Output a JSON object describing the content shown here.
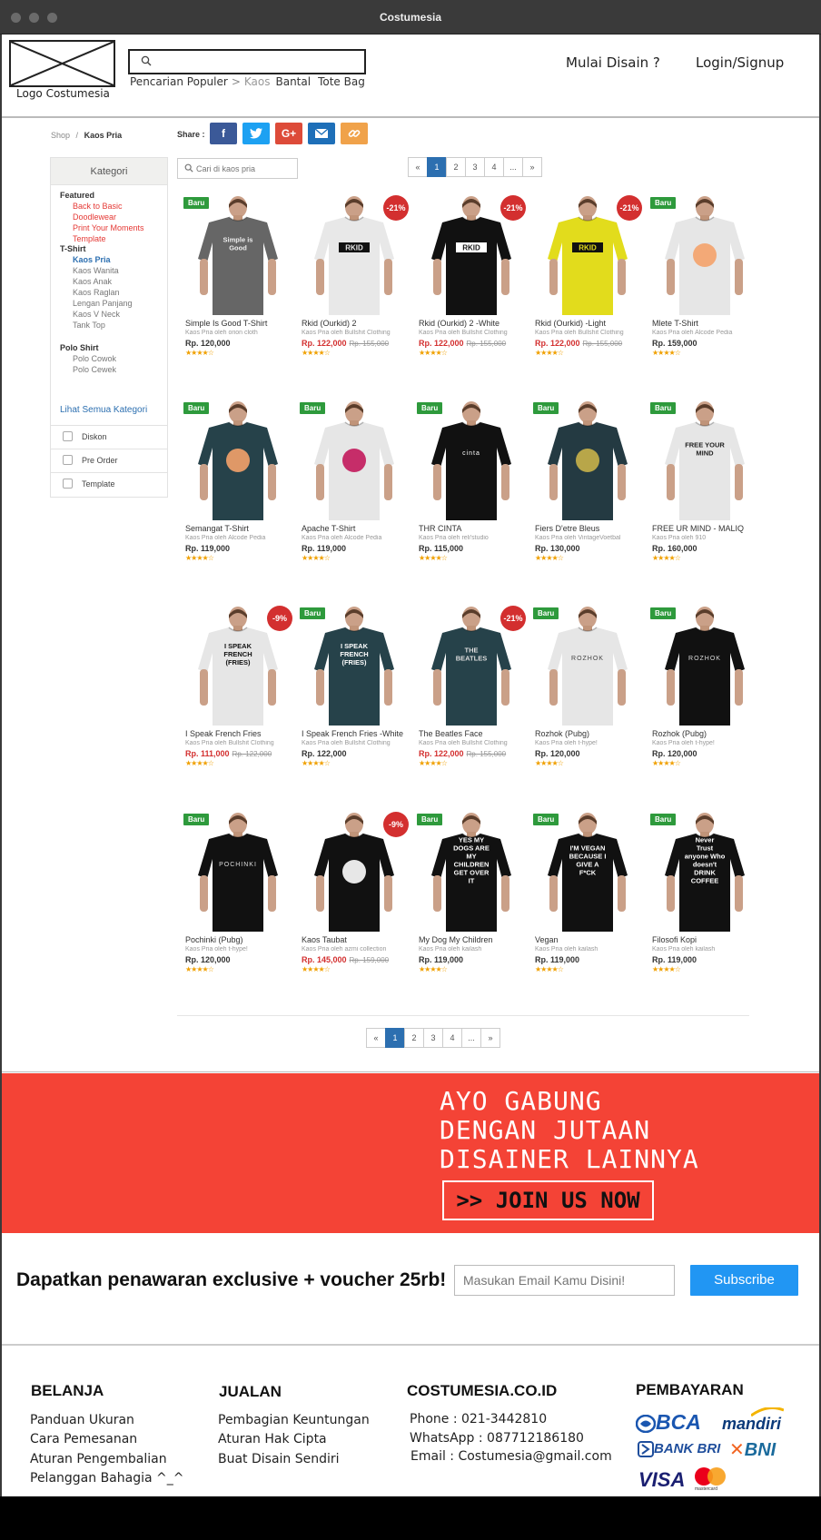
{
  "window": {
    "title": "Costumesia"
  },
  "header": {
    "logo_caption": "Logo Costumesia",
    "search_placeholder": "",
    "popular_label": "Pencarian Populer",
    "popular_sep": ">",
    "popular_tags": [
      "Kaos",
      "Bantal",
      "Tote Bag"
    ],
    "nav": {
      "design": "Mulai Disain ?",
      "login": "Login/Signup"
    }
  },
  "breadcrumb": {
    "root": "Shop",
    "sep": "/",
    "current": "Kaos Pria"
  },
  "share": {
    "label": "Share :",
    "buttons": [
      "f",
      "t",
      "G+",
      "✉",
      "🔗"
    ]
  },
  "sidebar": {
    "title": "Kategori",
    "groups": [
      {
        "label": "Featured",
        "items": [
          "Back to Basic",
          "Doodlewear",
          "Print Your Moments",
          "Template"
        ]
      },
      {
        "label": "T-Shirt",
        "items": [
          "Kaos Pria",
          "Kaos Wanita",
          "Kaos Anak",
          "Kaos Raglan",
          "Lengan Panjang",
          "Kaos V Neck",
          "Tank Top"
        ]
      },
      {
        "label": "Polo Shirt",
        "items": [
          "Polo Cowok",
          "Polo Cewek"
        ]
      }
    ],
    "see_all": "Lihat Semua Kategori",
    "filters": [
      "Diskon",
      "Pre Order",
      "Template"
    ]
  },
  "product_search": {
    "placeholder": "Cari di kaos pria"
  },
  "pagination": [
    "«",
    "1",
    "2",
    "3",
    "4",
    "...",
    "»"
  ],
  "pagination_active": "1",
  "products": [
    {
      "name": "Simple Is Good T-Shirt",
      "seller": "Kaos Pria oleh orion cloth",
      "price": "Rp. 120,000",
      "old": "",
      "badge": "Baru",
      "disc": "",
      "shirt": "#666666",
      "art": "Simple is Good",
      "art_color": "#eeeeee"
    },
    {
      "name": "Rkid (Ourkid) 2",
      "seller": "Kaos Pria oleh Bullshit Clothing",
      "price": "Rp. 122,000",
      "old": "Rp. 155,000",
      "badge": "",
      "disc": "-21%",
      "shirt": "#e8e8e8",
      "art": "RKID",
      "art_color": "#111111"
    },
    {
      "name": "Rkid (Ourkid) 2 -White",
      "seller": "Kaos Pria oleh Bullshit Clothing",
      "price": "Rp. 122,000",
      "old": "Rp. 155,000",
      "badge": "",
      "disc": "-21%",
      "shirt": "#111111",
      "art": "RKID",
      "art_color": "#ffffff"
    },
    {
      "name": "Rkid (Ourkid) -Light",
      "seller": "Kaos Pria oleh Bullshit Clothing",
      "price": "Rp. 122,000",
      "old": "Rp. 155,000",
      "badge": "",
      "disc": "-21%",
      "shirt": "#e2dc1c",
      "art": "RKID",
      "art_color": "#111111"
    },
    {
      "name": "Mlete T-Shirt",
      "seller": "Kaos Pria oleh Alcode Pedia",
      "price": "Rp. 159,000",
      "old": "",
      "badge": "Baru",
      "disc": "",
      "shirt": "#e6e6e6",
      "art": "",
      "art_color": "#f4a26a"
    },
    {
      "name": "Semangat T-Shirt",
      "seller": "Kaos Pria oleh Alcode Pedia",
      "price": "Rp. 119,000",
      "old": "",
      "badge": "Baru",
      "disc": "",
      "shirt": "#26424a",
      "art": "",
      "art_color": "#f4a26a"
    },
    {
      "name": "Apache T-Shirt",
      "seller": "Kaos Pria oleh Alcode Pedia",
      "price": "Rp. 119,000",
      "old": "",
      "badge": "Baru",
      "disc": "",
      "shirt": "#e6e6e6",
      "art": "",
      "art_color": "#c2185b"
    },
    {
      "name": "THR CINTA",
      "seller": "Kaos Pria oleh reli'studio",
      "price": "Rp. 115,000",
      "old": "",
      "badge": "Baru",
      "disc": "",
      "shirt": "#111111",
      "art": "cinta",
      "art_color": "#ffffff"
    },
    {
      "name": "Fiers D'etre Bleus",
      "seller": "Kaos Pria oleh VintageVoetbal",
      "price": "Rp. 130,000",
      "old": "",
      "badge": "Baru",
      "disc": "",
      "shirt": "#243a42",
      "art": "",
      "art_color": "#c9b24a"
    },
    {
      "name": "FREE UR MIND - MALIQ",
      "seller": "Kaos Pria oleh 910",
      "price": "Rp. 160,000",
      "old": "",
      "badge": "Baru",
      "disc": "",
      "shirt": "#e6e6e6",
      "art": "FREE YOUR MIND",
      "art_color": "#222222"
    },
    {
      "name": "I Speak French Fries",
      "seller": "Kaos Pria oleh Bullshit Clothing",
      "price": "Rp. 111,000",
      "old": "Rp. 122,000",
      "badge": "",
      "disc": "-9%",
      "shirt": "#e6e6e6",
      "art": "I SPEAK FRENCH (FRIES)",
      "art_color": "#111111"
    },
    {
      "name": "I Speak French Fries -White",
      "seller": "Kaos Pria oleh Bullshit Clothing",
      "price": "Rp. 122,000",
      "old": "",
      "badge": "Baru",
      "disc": "",
      "shirt": "#26424a",
      "art": "I SPEAK FRENCH (FRIES)",
      "art_color": "#ffffff"
    },
    {
      "name": "The Beatles Face",
      "seller": "Kaos Pria oleh Bullshit Clothing",
      "price": "Rp. 122,000",
      "old": "Rp. 155,000",
      "badge": "",
      "disc": "-21%",
      "shirt": "#26424a",
      "art": "THE BEATLES",
      "art_color": "#dddddd"
    },
    {
      "name": "Rozhok (Pubg)",
      "seller": "Kaos Pria oleh t-hype!",
      "price": "Rp. 120,000",
      "old": "",
      "badge": "Baru",
      "disc": "",
      "shirt": "#e6e6e6",
      "art": "ROZHOK",
      "art_color": "#444444"
    },
    {
      "name": "Rozhok (Pubg)",
      "seller": "Kaos Pria oleh t-hype!",
      "price": "Rp. 120,000",
      "old": "",
      "badge": "Baru",
      "disc": "",
      "shirt": "#111111",
      "art": "ROZHOK",
      "art_color": "#dddddd"
    },
    {
      "name": "Pochinki (Pubg)",
      "seller": "Kaos Pria oleh t-hype!",
      "price": "Rp. 120,000",
      "old": "",
      "badge": "Baru",
      "disc": "",
      "shirt": "#111111",
      "art": "POCHINKI",
      "art_color": "#dddddd"
    },
    {
      "name": "Kaos Taubat",
      "seller": "Kaos Pria oleh azmi collection",
      "price": "Rp. 145,000",
      "old": "Rp. 159,000",
      "badge": "",
      "disc": "-9%",
      "shirt": "#111111",
      "art": "",
      "art_color": "#ffffff"
    },
    {
      "name": "My Dog My Children",
      "seller": "Kaos Pria oleh kailash",
      "price": "Rp. 119,000",
      "old": "",
      "badge": "Baru",
      "disc": "",
      "shirt": "#111111",
      "art": "YES MY DOGS ARE MY CHILDREN GET OVER IT",
      "art_color": "#ffffff"
    },
    {
      "name": "Vegan",
      "seller": "Kaos Pria oleh kailash",
      "price": "Rp. 119,000",
      "old": "",
      "badge": "Baru",
      "disc": "",
      "shirt": "#111111",
      "art": "I'M VEGAN BECAUSE I GIVE A F*CK",
      "art_color": "#ffffff"
    },
    {
      "name": "Filosofi Kopi",
      "seller": "Kaos Pria oleh kailash",
      "price": "Rp. 119,000",
      "old": "",
      "badge": "Baru",
      "disc": "",
      "shirt": "#111111",
      "art": "Never Trust anyone Who doesn't DRINK COFFEE",
      "art_color": "#ffffff"
    }
  ],
  "banner": {
    "lines": [
      "AYO GABUNG",
      "DENGAN JUTAAN",
      "DISAINER LAINNYA"
    ],
    "cta": ">> JOIN US NOW"
  },
  "newsletter": {
    "title": "Dapatkan penawaran exclusive + voucher 25rb!",
    "placeholder": "Masukan Email Kamu Disini!",
    "button": "Subscribe"
  },
  "footer": {
    "belanja": {
      "title": "BELANJA",
      "items": [
        "Panduan Ukuran",
        "Cara Pemesanan",
        "Aturan Pengembalian",
        "Pelanggan Bahagia ^_^"
      ]
    },
    "jualan": {
      "title": "JUALAN",
      "items": [
        "Pembagian Keuntungan",
        "Aturan Hak Cipta",
        "Buat Disain Sendiri"
      ]
    },
    "contact": {
      "title": "COSTUMESIA.CO.ID",
      "items": [
        "Phone : 021-3442810",
        "WhatsApp : 087712186180",
        "Email : Costumesia@gmail.com"
      ]
    },
    "payment": {
      "title": "PEMBAYARAN",
      "logos": [
        "BCA",
        "mandiri",
        "BANK BRI",
        "BNI",
        "VISA",
        "mastercard"
      ]
    }
  },
  "colors": {
    "accent": "#2c6fb0",
    "banner": "#f44336",
    "subscribe": "#2196f3",
    "new_badge": "#2e9a3c",
    "discount": "#d32f2f"
  }
}
